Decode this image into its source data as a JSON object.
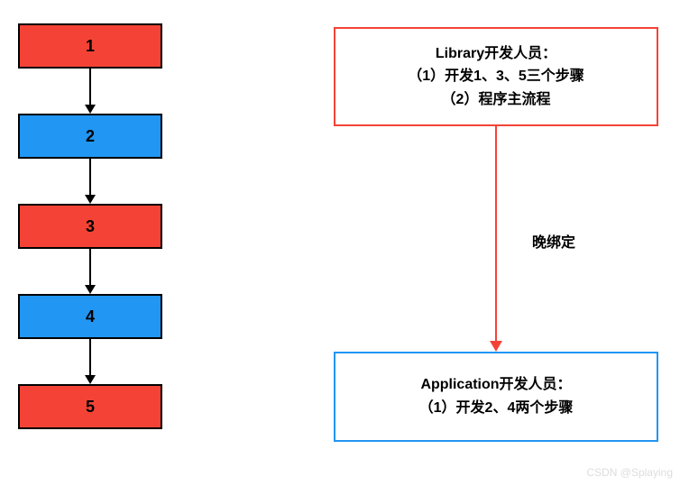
{
  "steps": {
    "s1": "1",
    "s2": "2",
    "s3": "3",
    "s4": "4",
    "s5": "5"
  },
  "library_box": {
    "line1": "Library开发人员：",
    "line2": "（1）开发1、3、5三个步骤",
    "line3": "（2）程序主流程"
  },
  "application_box": {
    "line1": "Application开发人员：",
    "line2": "（1）开发2、4两个步骤"
  },
  "connector_label": "晚绑定",
  "watermark": "CSDN @Splaying",
  "colors": {
    "red": "#f44336",
    "blue": "#2196f3"
  }
}
